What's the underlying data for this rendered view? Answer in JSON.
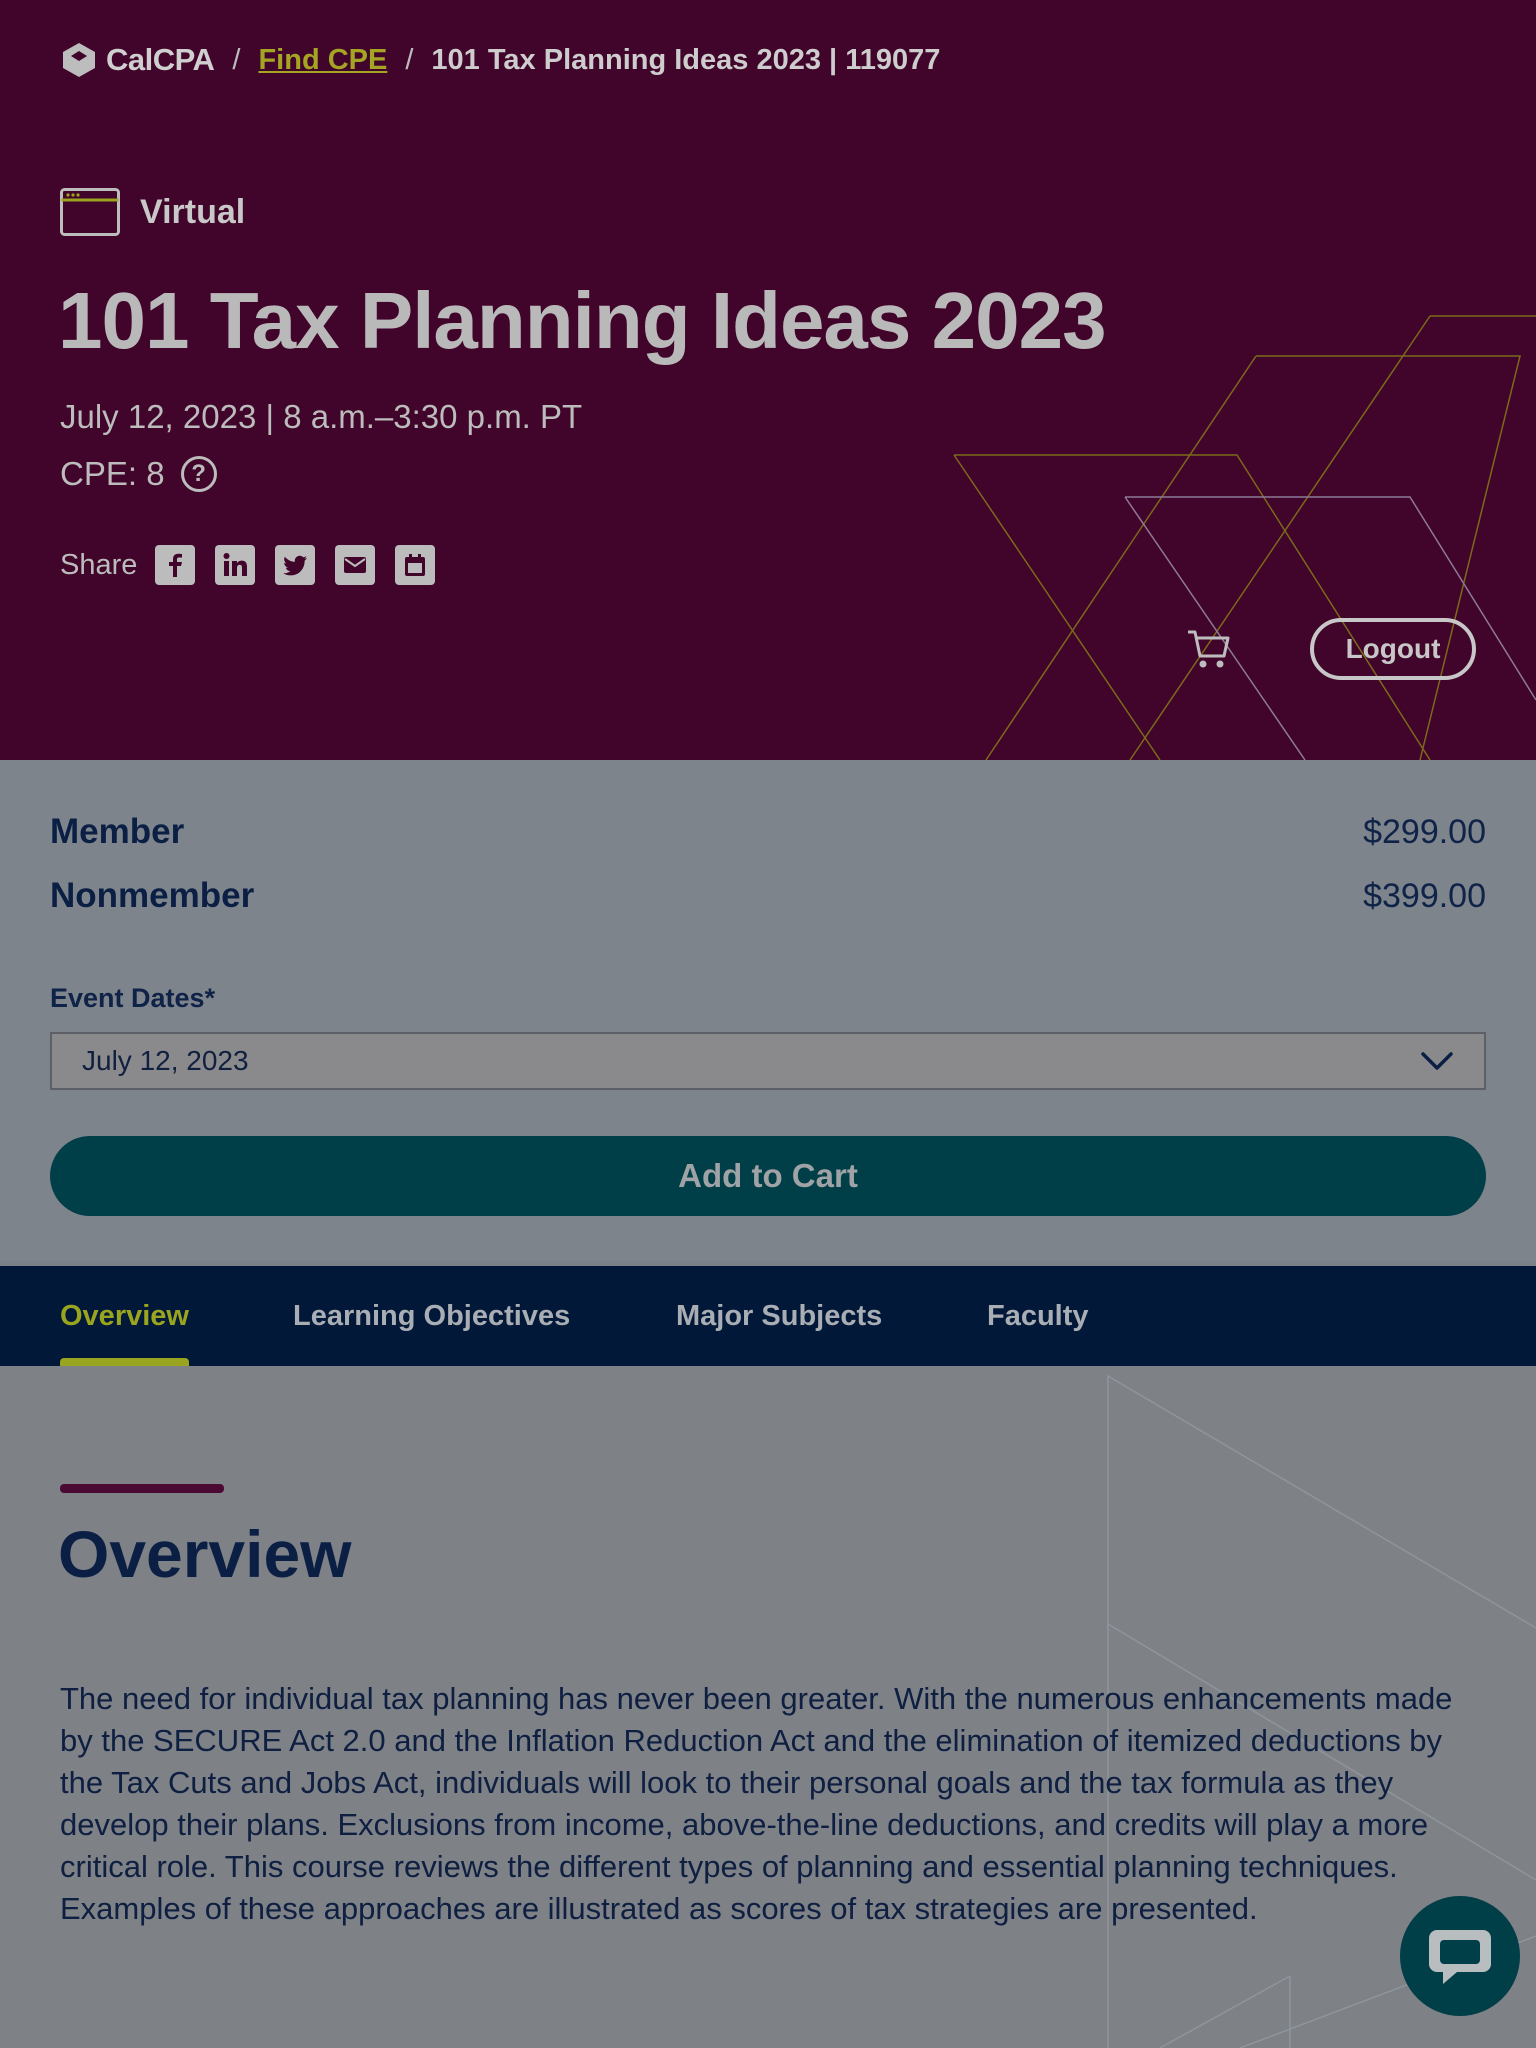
{
  "breadcrumb": {
    "logo_text": "CalCPA",
    "separator": "/",
    "link": "Find CPE",
    "current": "101 Tax Planning Ideas 2023 | 119077"
  },
  "hero": {
    "format": "Virtual",
    "title": "101 Tax Planning Ideas 2023",
    "date": "July 12, 2023 | 8 a.m.–3:30 p.m. PT",
    "cpe": "CPE: 8",
    "help_glyph": "?",
    "share_label": "Share",
    "share_icons": [
      "facebook-icon",
      "linkedin-icon",
      "twitter-icon",
      "email-icon",
      "calendar-icon"
    ],
    "logout": "Logout"
  },
  "pricing": {
    "member_label": "Member",
    "member_price": "$299.00",
    "nonmember_label": "Nonmember",
    "nonmember_price": "$399.00",
    "event_dates_label": "Event Dates*",
    "selected_date": "July 12, 2023",
    "add_to_cart": "Add to Cart"
  },
  "tabs": [
    {
      "label": "Overview",
      "active": true
    },
    {
      "label": "Learning Objectives",
      "active": false
    },
    {
      "label": "Major Subjects",
      "active": false
    },
    {
      "label": "Faculty",
      "active": false
    }
  ],
  "overview": {
    "heading": "Overview",
    "body": "The need for individual tax planning has never been greater. With the numerous enhancements made by the SECURE Act 2.0 and the Inflation Reduction Act and the elimination of itemized deductions by the Tax Cuts and Jobs Act, individuals will look to their personal goals and the tax formula as they develop their plans. Exclusions from income, above-the-line deductions, and credits will play a more critical role. This course reviews the different types of planning and essential planning techniques. Examples of these approaches are illustrated as scores of tax strategies are presented."
  },
  "colors": {
    "hero_bg": "#41042a",
    "accent_lime": "#9aa51f",
    "navy": "#0b1f45",
    "teal": "#003e48"
  }
}
